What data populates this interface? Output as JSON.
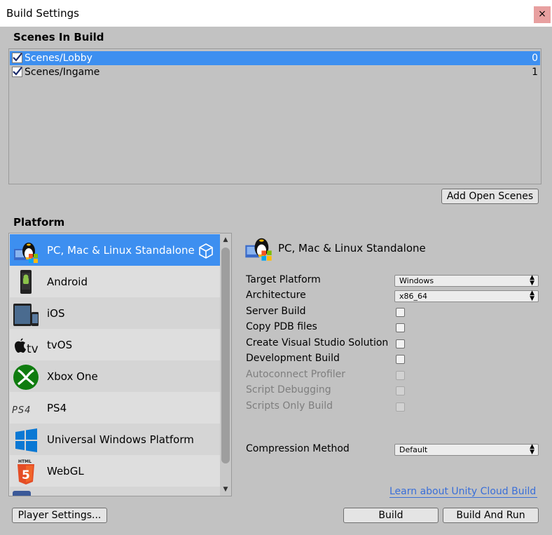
{
  "window": {
    "title": "Build Settings",
    "close_glyph": "×"
  },
  "scenes": {
    "heading": "Scenes In Build",
    "items": [
      {
        "name": "Scenes/Lobby",
        "index": "0",
        "checked": true,
        "selected": true
      },
      {
        "name": "Scenes/Ingame",
        "index": "1",
        "checked": true,
        "selected": false
      }
    ],
    "add_open_scenes_label": "Add Open Scenes"
  },
  "platform": {
    "heading": "Platform",
    "items": [
      {
        "label": "PC, Mac & Linux Standalone",
        "icon": "linux-tux-icon",
        "selected": true
      },
      {
        "label": "Android",
        "icon": "android-phone-icon"
      },
      {
        "label": "iOS",
        "icon": "ios-devices-icon"
      },
      {
        "label": "tvOS",
        "icon": "apple-tv-icon"
      },
      {
        "label": "Xbox One",
        "icon": "xbox-icon"
      },
      {
        "label": "PS4",
        "icon": "ps4-logo-icon"
      },
      {
        "label": "Universal Windows Platform",
        "icon": "windows-logo-icon"
      },
      {
        "label": "WebGL",
        "icon": "html5-icon"
      }
    ],
    "player_settings_label": "Player Settings..."
  },
  "details": {
    "title": "PC, Mac & Linux Standalone",
    "target_platform": {
      "label": "Target Platform",
      "value": "Windows"
    },
    "architecture": {
      "label": "Architecture",
      "value": "x86_64"
    },
    "server_build": {
      "label": "Server Build",
      "checked": false
    },
    "copy_pdb": {
      "label": "Copy PDB files",
      "checked": false
    },
    "create_vs": {
      "label": "Create Visual Studio Solution",
      "checked": false
    },
    "development_build": {
      "label": "Development Build",
      "checked": false
    },
    "autoconnect_profiler": {
      "label": "Autoconnect Profiler",
      "enabled": false
    },
    "script_debugging": {
      "label": "Script Debugging",
      "enabled": false
    },
    "scripts_only_build": {
      "label": "Scripts Only Build",
      "enabled": false
    },
    "compression": {
      "label": "Compression Method",
      "value": "Default"
    },
    "cloud_link": "Learn about Unity Cloud Build",
    "build_label": "Build",
    "build_and_run_label": "Build And Run"
  },
  "colors": {
    "selection": "#3d8ff0",
    "background": "#c2c2c2",
    "link": "#3a6fd8"
  }
}
